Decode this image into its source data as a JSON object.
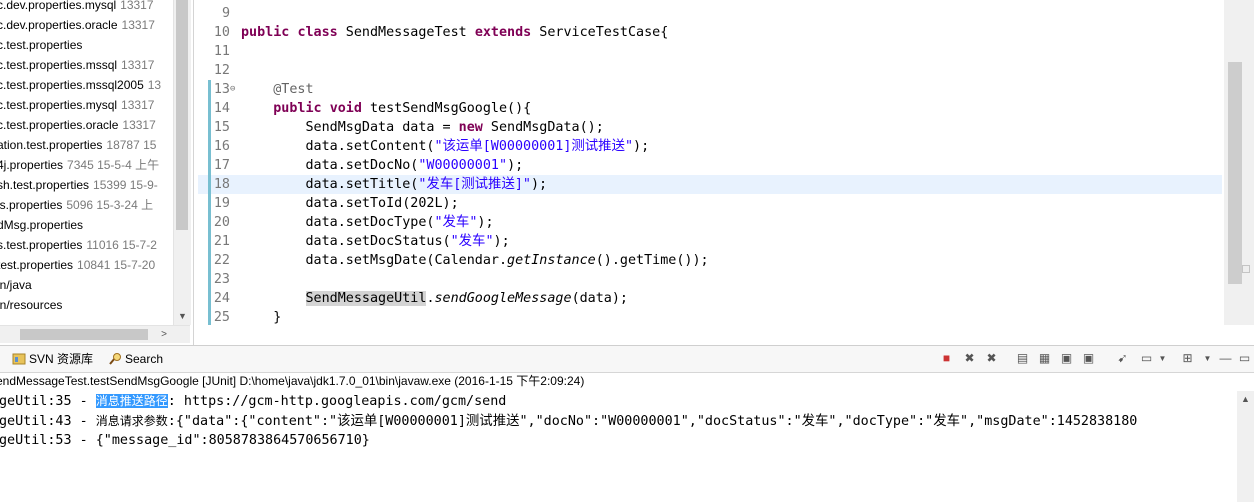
{
  "tree": {
    "items": [
      {
        "name": "c.dev.properties.mysql",
        "meta": "13317"
      },
      {
        "name": "c.dev.properties.oracle",
        "meta": "13317"
      },
      {
        "name": "c.test.properties",
        "meta": ""
      },
      {
        "name": "c.test.properties.mssql",
        "meta": "13317"
      },
      {
        "name": "c.test.properties.mssql2005",
        "meta": "13"
      },
      {
        "name": "c.test.properties.mysql",
        "meta": "13317"
      },
      {
        "name": "c.test.properties.oracle",
        "meta": "13317"
      },
      {
        "name": "ation.test.properties",
        "meta": "18787  15"
      },
      {
        "name": "4j.properties",
        "meta": "7345  15-5-4 上午"
      },
      {
        "name": "sh.test.properties",
        "meta": "15399  15-9-"
      },
      {
        "name": "is.properties",
        "meta": "5096  15-3-24 上"
      },
      {
        "name": "dMsg.properties",
        "meta": ""
      },
      {
        "name": "s.test.properties",
        "meta": "11016  15-7-2"
      },
      {
        "name": "test.properties",
        "meta": "10841  15-7-20"
      },
      {
        "name": "in/java",
        "meta": ""
      },
      {
        "name": "in/resources",
        "meta": ""
      },
      {
        "name": "",
        "meta": ""
      }
    ]
  },
  "editor": {
    "lines": [
      {
        "n": "9",
        "html": ""
      },
      {
        "n": "10",
        "html": "<span class=\"kw\">public</span> <span class=\"kw\">class</span> SendMessageTest <span class=\"kw\">extends</span> ServiceTestCase{"
      },
      {
        "n": "11",
        "html": ""
      },
      {
        "n": "12",
        "html": ""
      },
      {
        "n": "13",
        "html": "    <span class=\"ann\">@Test</span>"
      },
      {
        "n": "14",
        "html": "    <span class=\"kw\">public</span> <span class=\"kw\">void</span> testSendMsgGoogle(){"
      },
      {
        "n": "15",
        "html": "        SendMsgData data = <span class=\"kw\">new</span> SendMsgData();"
      },
      {
        "n": "16",
        "html": "        data.setContent(<span class=\"str\">\"该运单[W00000001]测试推送\"</span>);"
      },
      {
        "n": "17",
        "html": "        data.setDocNo(<span class=\"str\">\"W00000001\"</span>);"
      },
      {
        "n": "18",
        "html": "        data.setTitle(<span class=\"str\">\"发车[测试推送]\"</span>);"
      },
      {
        "n": "19",
        "html": "        data.setToId(202L);"
      },
      {
        "n": "20",
        "html": "        data.setDocType(<span class=\"str\">\"发车\"</span>);"
      },
      {
        "n": "21",
        "html": "        data.setDocStatus(<span class=\"str\">\"发车\"</span>);"
      },
      {
        "n": "22",
        "html": "        data.setMsgDate(Calendar.<span class=\"it\">getInstance</span>().getTime());"
      },
      {
        "n": "23",
        "html": ""
      },
      {
        "n": "24",
        "html": "        <span class=\"hl\">SendMessageUtil</span>.<span class=\"it\">sendGoogleMessage</span>(data);"
      },
      {
        "n": "25",
        "html": "    }"
      }
    ]
  },
  "tabs": {
    "svn": "SVN 资源库",
    "search": "Search"
  },
  "console": {
    "header": "endMessageTest.testSendMsgGoogle [JUnit] D:\\home\\java\\jdk1.7.0_01\\bin\\javaw.exe (2016-1-15 下午2:09:24)",
    "l1_prefix": "geUtil:35 - ",
    "l1_sel": "消息推送路径",
    "l1_rest": ": https://gcm-http.googleapis.com/gcm/send",
    "l2_prefix": "geUtil:43 - ",
    "l2_cn": "消息请求参数",
    "l2_rest": ":{\"data\":{\"content\":\"该运单[W00000001]测试推送\",\"docNo\":\"W00000001\",\"docStatus\":\"发车\",\"docType\":\"发车\",\"msgDate\":1452838180",
    "l3": "geUtil:53 - {\"message_id\":8058783864570656710}"
  }
}
